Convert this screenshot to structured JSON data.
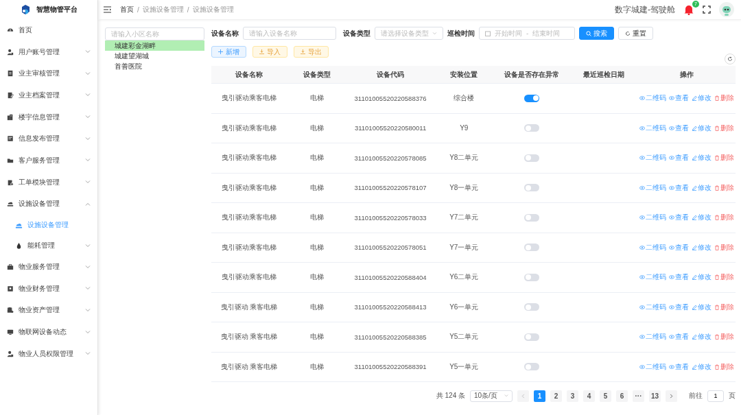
{
  "sidebar": {
    "logo_title": "智慧物管平台",
    "items": [
      {
        "label": "首页",
        "selected": false
      },
      {
        "label": "用户账号管理",
        "selected": false,
        "expanded": false
      },
      {
        "label": "业主审核管理",
        "selected": false,
        "expanded": false
      },
      {
        "label": "业主档案管理",
        "selected": false,
        "expanded": false
      },
      {
        "label": "楼宇信息管理",
        "selected": false,
        "expanded": false
      },
      {
        "label": "信息发布管理",
        "selected": false,
        "expanded": false
      },
      {
        "label": "客户服务管理",
        "selected": false,
        "expanded": false
      },
      {
        "label": "工单模块管理",
        "selected": false,
        "expanded": false
      },
      {
        "label": "设施设备管理",
        "selected": false,
        "expanded": true,
        "children": [
          {
            "label": "设施设备管理",
            "selected": true
          },
          {
            "label": "能耗管理",
            "selected": false,
            "expanded": false
          }
        ]
      },
      {
        "label": "物业服务管理",
        "selected": false,
        "expanded": false
      },
      {
        "label": "物业财务管理",
        "selected": false,
        "expanded": false
      },
      {
        "label": "物业资产管理",
        "selected": false,
        "expanded": false
      },
      {
        "label": "物联网设备动态",
        "selected": false,
        "expanded": false
      },
      {
        "label": "物业人员权限管理",
        "selected": false,
        "expanded": false
      }
    ]
  },
  "header": {
    "breadcrumb": [
      "首页",
      "设施设备管理",
      "设施设备管理"
    ],
    "breadcrumb_separator": "/",
    "title": "数字城建-驾驶舱",
    "notification_count": "7"
  },
  "tree": {
    "placeholder": "请输入小区名称",
    "items": [
      {
        "label": "城建彩金湖畔",
        "selected": true
      },
      {
        "label": "城建望湖城",
        "selected": false
      },
      {
        "label": "首善医院",
        "selected": false
      }
    ]
  },
  "filters": {
    "name_label": "设备名称",
    "name_placeholder": "请输入设备名称",
    "type_label": "设备类型",
    "type_placeholder": "请选择设备类型",
    "time_label": "巡检时间",
    "start_placeholder": "开始时间",
    "range_separator": "-",
    "end_placeholder": "结束时间",
    "search_button": "搜索",
    "reset_button": "重置"
  },
  "toolbar": [
    "新增",
    "导入",
    "导出"
  ],
  "table": {
    "columns": [
      "设备名称",
      "设备类型",
      "设备代码",
      "安装位置",
      "设备是否存在异常",
      "最近巡检日期",
      "操作"
    ],
    "rows": [
      {
        "name": "曳引驱动乘客电梯",
        "type": "电梯",
        "code": "31101005520220588376",
        "location": "综合楼",
        "abnormal": true,
        "actions": [
          "二维码",
          "查看",
          "修改",
          "删除"
        ]
      },
      {
        "name": "曳引驱动乘客电梯",
        "type": "电梯",
        "code": "31101005520220580011",
        "location": "Y9",
        "abnormal": false,
        "actions": [
          "二维码",
          "查看",
          "修改",
          "删除"
        ]
      },
      {
        "name": "曳引驱动乘客电梯",
        "type": "电梯",
        "code": "31101005520220578085",
        "location": "Y8二单元",
        "abnormal": false,
        "actions": [
          "二维码",
          "查看",
          "修改",
          "删除"
        ]
      },
      {
        "name": "曳引驱动乘客电梯",
        "type": "电梯",
        "code": "31101005520220578107",
        "location": "Y8一单元",
        "abnormal": false,
        "actions": [
          "二维码",
          "查看",
          "修改",
          "删除"
        ]
      },
      {
        "name": "曳引驱动乘客电梯",
        "type": "电梯",
        "code": "31101005520220578033",
        "location": "Y7二单元",
        "abnormal": false,
        "actions": [
          "二维码",
          "查看",
          "修改",
          "删除"
        ]
      },
      {
        "name": "曳引驱动乘客电梯",
        "type": "电梯",
        "code": "31101005520220578051",
        "location": "Y7一单元",
        "abnormal": false,
        "actions": [
          "二维码",
          "查看",
          "修改",
          "删除"
        ]
      },
      {
        "name": "曳引驱动乘客电梯",
        "type": "电梯",
        "code": "31101005520220588404",
        "location": "Y6二单元",
        "abnormal": false,
        "actions": [
          "二维码",
          "查看",
          "修改",
          "删除"
        ]
      },
      {
        "name": "曳引驱动 乘客电梯",
        "type": "电梯",
        "code": "31101005520220588413",
        "location": "Y6一单元",
        "abnormal": false,
        "actions": [
          "二维码",
          "查看",
          "修改",
          "删除"
        ]
      },
      {
        "name": "曳引驱动 乘客电梯",
        "type": "电梯",
        "code": "31101005520220588385",
        "location": "Y5二单元",
        "abnormal": false,
        "actions": [
          "二维码",
          "查看",
          "修改",
          "删除"
        ]
      },
      {
        "name": "曳引驱动 乘客电梯",
        "type": "电梯",
        "code": "31101005520220588391",
        "location": "Y5一单元",
        "abnormal": false,
        "actions": [
          "二维码",
          "查看",
          "修改",
          "删除"
        ]
      }
    ]
  },
  "pagination": {
    "total": "共 124 条",
    "page_size": "10条/页",
    "pages": [
      {
        "label": "1",
        "selected": true
      },
      {
        "label": "2",
        "selected": false
      },
      {
        "label": "3",
        "selected": false
      },
      {
        "label": "4",
        "selected": false
      },
      {
        "label": "5",
        "selected": false
      },
      {
        "label": "6",
        "selected": false
      },
      {
        "label": "···",
        "selected": false
      },
      {
        "label": "13",
        "selected": false
      }
    ],
    "goto_label": "前往",
    "goto_value": "1",
    "goto_unit": "页"
  }
}
